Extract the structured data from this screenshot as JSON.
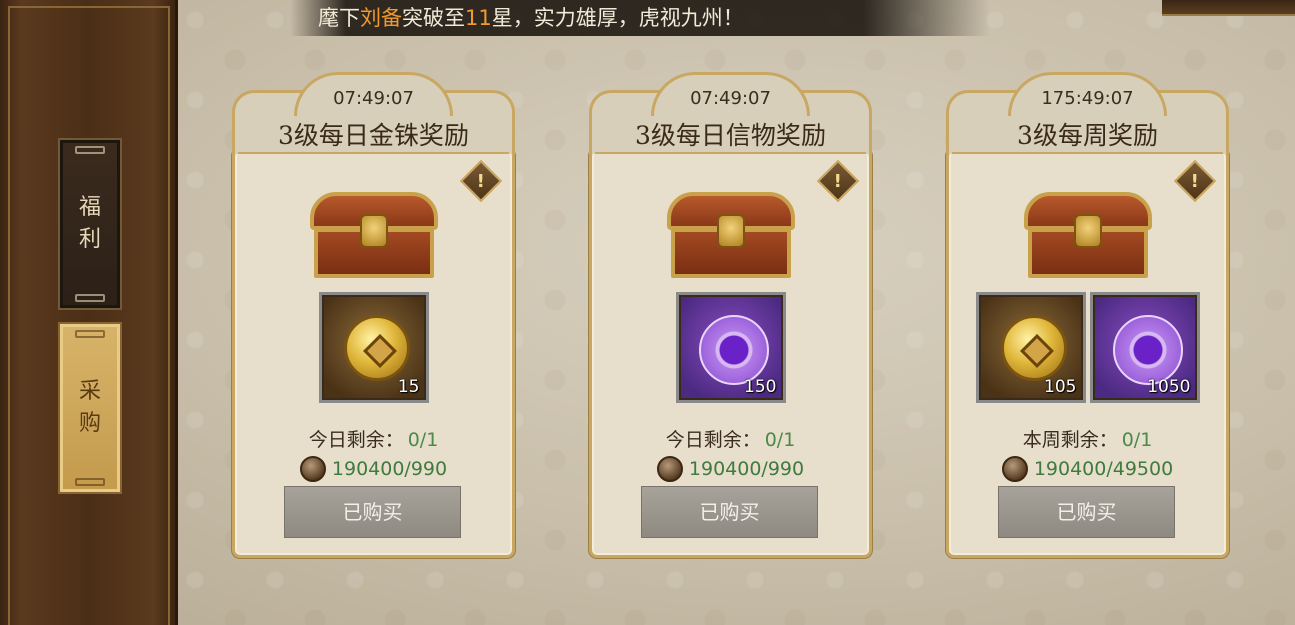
{
  "marquee": {
    "prefix": "麾下",
    "name": "刘备",
    "middle": "突破至",
    "stars": "11",
    "suffix": "星，实力雄厚，虎视九州！",
    "highlight_color": "#f09a2e"
  },
  "sidebar": {
    "tabs": [
      {
        "line1": "福",
        "line2": "利",
        "selected": false
      },
      {
        "line1": "采",
        "line2": "购",
        "selected": true
      }
    ]
  },
  "cards": [
    {
      "timer": "07:49:07",
      "title": "3级每日金铢奖励",
      "items": [
        {
          "icon": "gold-coin",
          "count": "15"
        }
      ],
      "remain_label": "今日剩余：",
      "remain_value": "0/1",
      "cost": "190400/990",
      "button": "已购买"
    },
    {
      "timer": "07:49:07",
      "title": "3级每日信物奖励",
      "items": [
        {
          "icon": "purple-jade",
          "count": "150"
        }
      ],
      "remain_label": "今日剩余：",
      "remain_value": "0/1",
      "cost": "190400/990",
      "button": "已购买"
    },
    {
      "timer": "175:49:07",
      "title": "3级每周奖励",
      "items": [
        {
          "icon": "gold-coin",
          "count": "105"
        },
        {
          "icon": "purple-jade",
          "count": "1050"
        }
      ],
      "remain_label": "本周剩余：",
      "remain_value": "0/1",
      "cost": "190400/49500",
      "button": "已购买"
    }
  ],
  "icons": {
    "info": "!",
    "chest": "treasure-chest-icon",
    "currency": "copper-coin-icon"
  }
}
